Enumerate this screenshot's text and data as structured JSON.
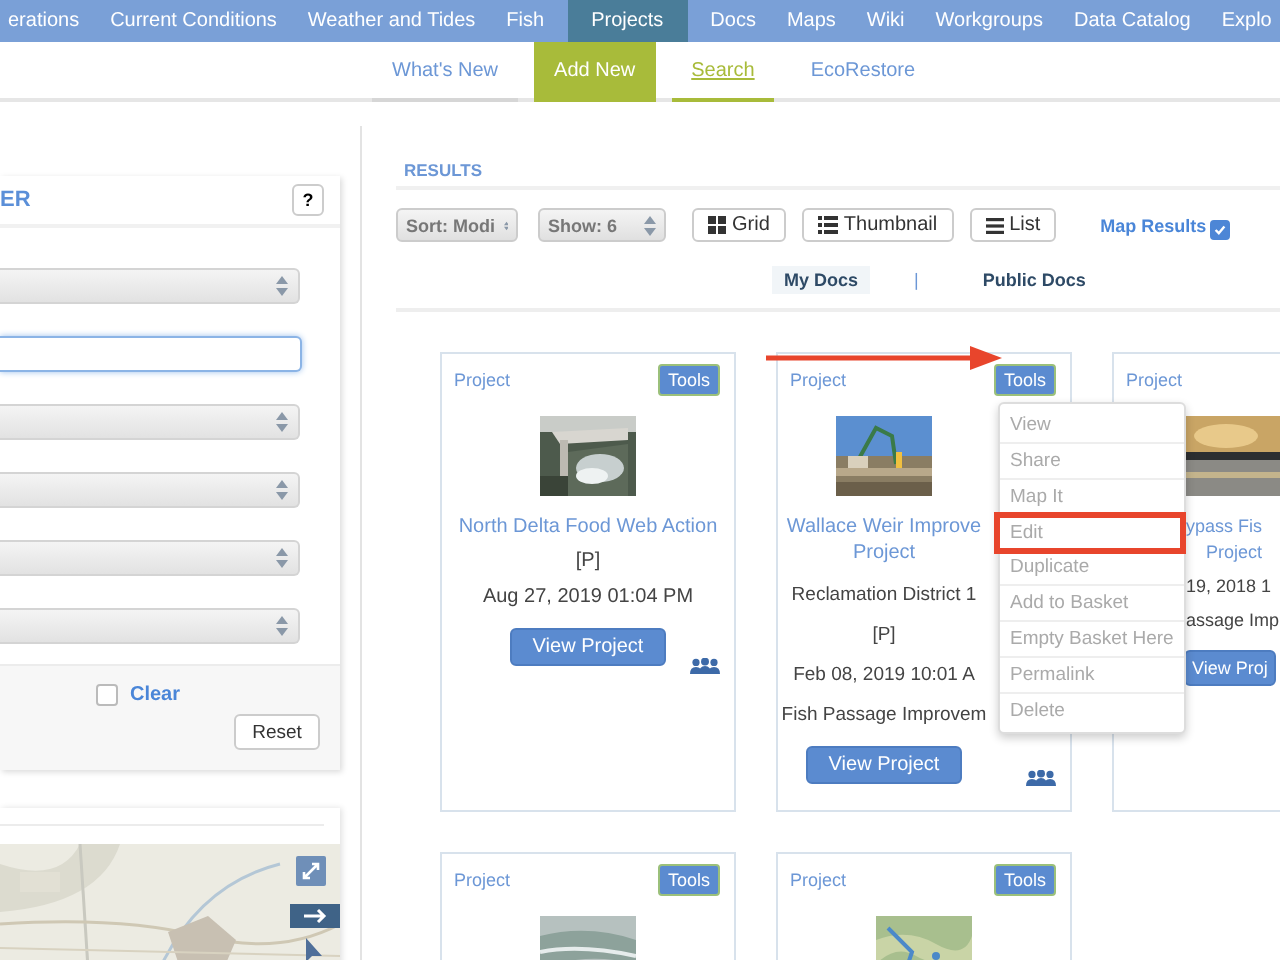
{
  "top_nav": [
    {
      "label": "erations",
      "selected": false
    },
    {
      "label": "Current Conditions",
      "selected": false
    },
    {
      "label": "Weather and Tides",
      "selected": false
    },
    {
      "label": "Fish",
      "selected": false
    },
    {
      "label": "Projects",
      "selected": true
    },
    {
      "label": "Docs",
      "selected": false
    },
    {
      "label": "Maps",
      "selected": false
    },
    {
      "label": "Wiki",
      "selected": false
    },
    {
      "label": "Workgroups",
      "selected": false
    },
    {
      "label": "Data Catalog",
      "selected": false
    },
    {
      "label": "Explo",
      "selected": false
    }
  ],
  "sub_nav": [
    {
      "label": "What's New",
      "kind": "tab",
      "selected": false
    },
    {
      "label": "Add New",
      "kind": "button",
      "selected": false
    },
    {
      "label": "Search",
      "kind": "tab",
      "selected": true
    },
    {
      "label": "EcoRestore",
      "kind": "tab",
      "selected": false
    }
  ],
  "filter": {
    "title": "ER",
    "help": "?",
    "fields": [
      {
        "kind": "select"
      },
      {
        "kind": "input",
        "focused": true
      },
      {
        "kind": "select"
      },
      {
        "kind": "select"
      },
      {
        "kind": "select"
      },
      {
        "kind": "select"
      }
    ],
    "clear": {
      "label": "Clear",
      "checked": false
    },
    "reset": "Reset"
  },
  "results": {
    "title": "RESULTS",
    "sort": "Sort: Modi",
    "show": "Show: 6",
    "views": [
      {
        "label": "Grid",
        "kind": "grid"
      },
      {
        "label": "Thumbnail",
        "kind": "thumbnail"
      },
      {
        "label": "List",
        "kind": "list"
      }
    ],
    "map_results": {
      "label": "Map Results",
      "checked": true
    },
    "doc_tabs": [
      {
        "label": "My Docs",
        "selected": true
      },
      {
        "label": "Public Docs",
        "selected": false
      }
    ],
    "separator": "|",
    "cards": [
      {
        "type": "Project",
        "tools": "Tools",
        "title_lines": [
          "North Delta Food Web Action"
        ],
        "lines": [
          "[P]",
          "Aug 27, 2019 01:04 PM"
        ],
        "button": "View Project",
        "shared": true
      },
      {
        "type": "Project",
        "tools": "Tools",
        "title_lines": [
          "Wallace Weir Improve",
          "Project"
        ],
        "lines": [
          "Reclamation District 1",
          "[P]",
          "Feb 08, 2019 10:01 A",
          "Fish Passage Improvem"
        ],
        "button": "View Project",
        "shared": true
      },
      {
        "type": "Project",
        "title_lines": [
          "ypass Fis",
          "Project"
        ],
        "lines": [
          "19, 2018 1",
          "assage Imp"
        ],
        "button": "View Proj"
      },
      {
        "type": "Project",
        "tools": "Tools"
      },
      {
        "type": "Project",
        "tools": "Tools"
      }
    ]
  },
  "tools_menu": [
    {
      "label": "View",
      "highlighted": false
    },
    {
      "label": "Share",
      "highlighted": false
    },
    {
      "label": "Map It",
      "highlighted": false
    },
    {
      "label": "Edit",
      "highlighted": true
    },
    {
      "label": "Duplicate",
      "highlighted": false
    },
    {
      "label": "Add to Basket",
      "highlighted": false
    },
    {
      "label": "Empty Basket Here",
      "highlighted": false
    },
    {
      "label": "Permalink",
      "highlighted": false
    },
    {
      "label": "Delete",
      "highlighted": false
    }
  ]
}
